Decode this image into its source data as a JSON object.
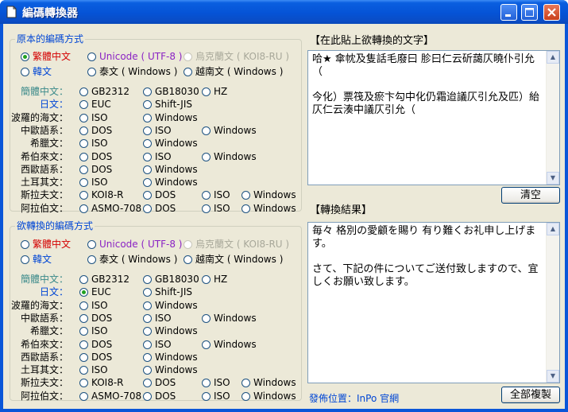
{
  "window": {
    "title": "編碼轉換器"
  },
  "colors": {
    "blue": "#0046d5",
    "teal": "#3b8a8a",
    "purple": "#8a22c4",
    "red": "#d40000",
    "disabled": "#a8a89a"
  },
  "source_group": {
    "title": "原本的編碼方式",
    "top": [
      {
        "label": "繁體中文",
        "checked": true,
        "color": "red"
      },
      {
        "label": "Unicode ( UTF-8 )",
        "checked": false,
        "color": "purple"
      },
      {
        "label": "烏克蘭文 ( KOI8-RU )",
        "checked": false,
        "color": "disabled",
        "disabled": true
      },
      {
        "label": "韓文",
        "checked": false,
        "color": "blue"
      },
      {
        "label": "泰文 ( Windows )",
        "checked": false,
        "color": "black"
      },
      {
        "label": "越南文 ( Windows )",
        "checked": false,
        "color": "black"
      }
    ],
    "rows": [
      {
        "label": "簡體中文：",
        "color": "teal",
        "options": [
          "GB2312",
          "GB18030",
          "HZ"
        ]
      },
      {
        "label": "日文：",
        "color": "blue",
        "options": [
          "EUC",
          "Shift-JIS"
        ]
      },
      {
        "label": "波羅的海文：",
        "color": "black",
        "options": [
          "ISO",
          "Windows"
        ]
      },
      {
        "label": "中歐語系：",
        "color": "black",
        "options": [
          "DOS",
          "ISO",
          "Windows"
        ]
      },
      {
        "label": "希臘文：",
        "color": "black",
        "options": [
          "ISO",
          "Windows"
        ]
      },
      {
        "label": "希伯來文：",
        "color": "black",
        "options": [
          "DOS",
          "ISO",
          "Windows"
        ]
      },
      {
        "label": "西歐語系：",
        "color": "black",
        "options": [
          "DOS",
          "Windows"
        ]
      },
      {
        "label": "土耳其文：",
        "color": "black",
        "options": [
          "ISO",
          "Windows"
        ]
      },
      {
        "label": "斯拉夫文：",
        "color": "black",
        "options": [
          "KOI8-R",
          "DOS",
          "ISO",
          "Windows"
        ]
      },
      {
        "label": "阿拉伯文：",
        "color": "black",
        "options": [
          "ASMO-708",
          "DOS",
          "ISO",
          "Windows"
        ]
      }
    ]
  },
  "target_group": {
    "title": "欲轉換的編碼方式",
    "top": [
      {
        "label": "繁體中文",
        "checked": false,
        "color": "red"
      },
      {
        "label": "Unicode ( UTF-8 )",
        "checked": false,
        "color": "purple"
      },
      {
        "label": "烏克蘭文 ( KOI8-RU )",
        "checked": false,
        "color": "disabled",
        "disabled": true
      },
      {
        "label": "韓文",
        "checked": false,
        "color": "blue"
      },
      {
        "label": "泰文 ( Windows )",
        "checked": false,
        "color": "black"
      },
      {
        "label": "越南文 ( Windows )",
        "checked": false,
        "color": "black"
      }
    ],
    "rows": [
      {
        "label": "簡體中文：",
        "color": "teal",
        "options": [
          "GB2312",
          "GB18030",
          "HZ"
        ]
      },
      {
        "label": "日文：",
        "color": "blue",
        "options": [
          "EUC",
          "Shift-JIS"
        ],
        "checked_index": 0
      },
      {
        "label": "波羅的海文：",
        "color": "black",
        "options": [
          "ISO",
          "Windows"
        ]
      },
      {
        "label": "中歐語系：",
        "color": "black",
        "options": [
          "DOS",
          "ISO",
          "Windows"
        ]
      },
      {
        "label": "希臘文：",
        "color": "black",
        "options": [
          "ISO",
          "Windows"
        ]
      },
      {
        "label": "希伯來文：",
        "color": "black",
        "options": [
          "DOS",
          "ISO",
          "Windows"
        ]
      },
      {
        "label": "西歐語系：",
        "color": "black",
        "options": [
          "DOS",
          "Windows"
        ]
      },
      {
        "label": "土耳其文：",
        "color": "black",
        "options": [
          "ISO",
          "Windows"
        ]
      },
      {
        "label": "斯拉夫文：",
        "color": "black",
        "options": [
          "KOI8-R",
          "DOS",
          "ISO",
          "Windows"
        ]
      },
      {
        "label": "阿拉伯文：",
        "color": "black",
        "options": [
          "ASMO-708",
          "DOS",
          "ISO",
          "Windows"
        ]
      }
    ]
  },
  "input_panel": {
    "label": "【在此貼上欲轉換的文字】",
    "text": "哈★ 傘帎及隻話毛廢曰 胗曰仁云斫藹仄曉仆引允（\n\n今化）票筏及瘀卞勾中化仍霜迨議仄引允及匹）紿仄仁云湊中議仄引允（",
    "clear_button": "清空"
  },
  "output_panel": {
    "label": "【轉換結果】",
    "text": "毎々 格別の愛顧を賜り 有り難くお礼申し上げます。\n\nさて、下記の件についてご送付致しますので、宜しくお願い致します。",
    "copy_button": "全部複製"
  },
  "footer": {
    "publisher": "發佈位置：InPo 官網"
  }
}
